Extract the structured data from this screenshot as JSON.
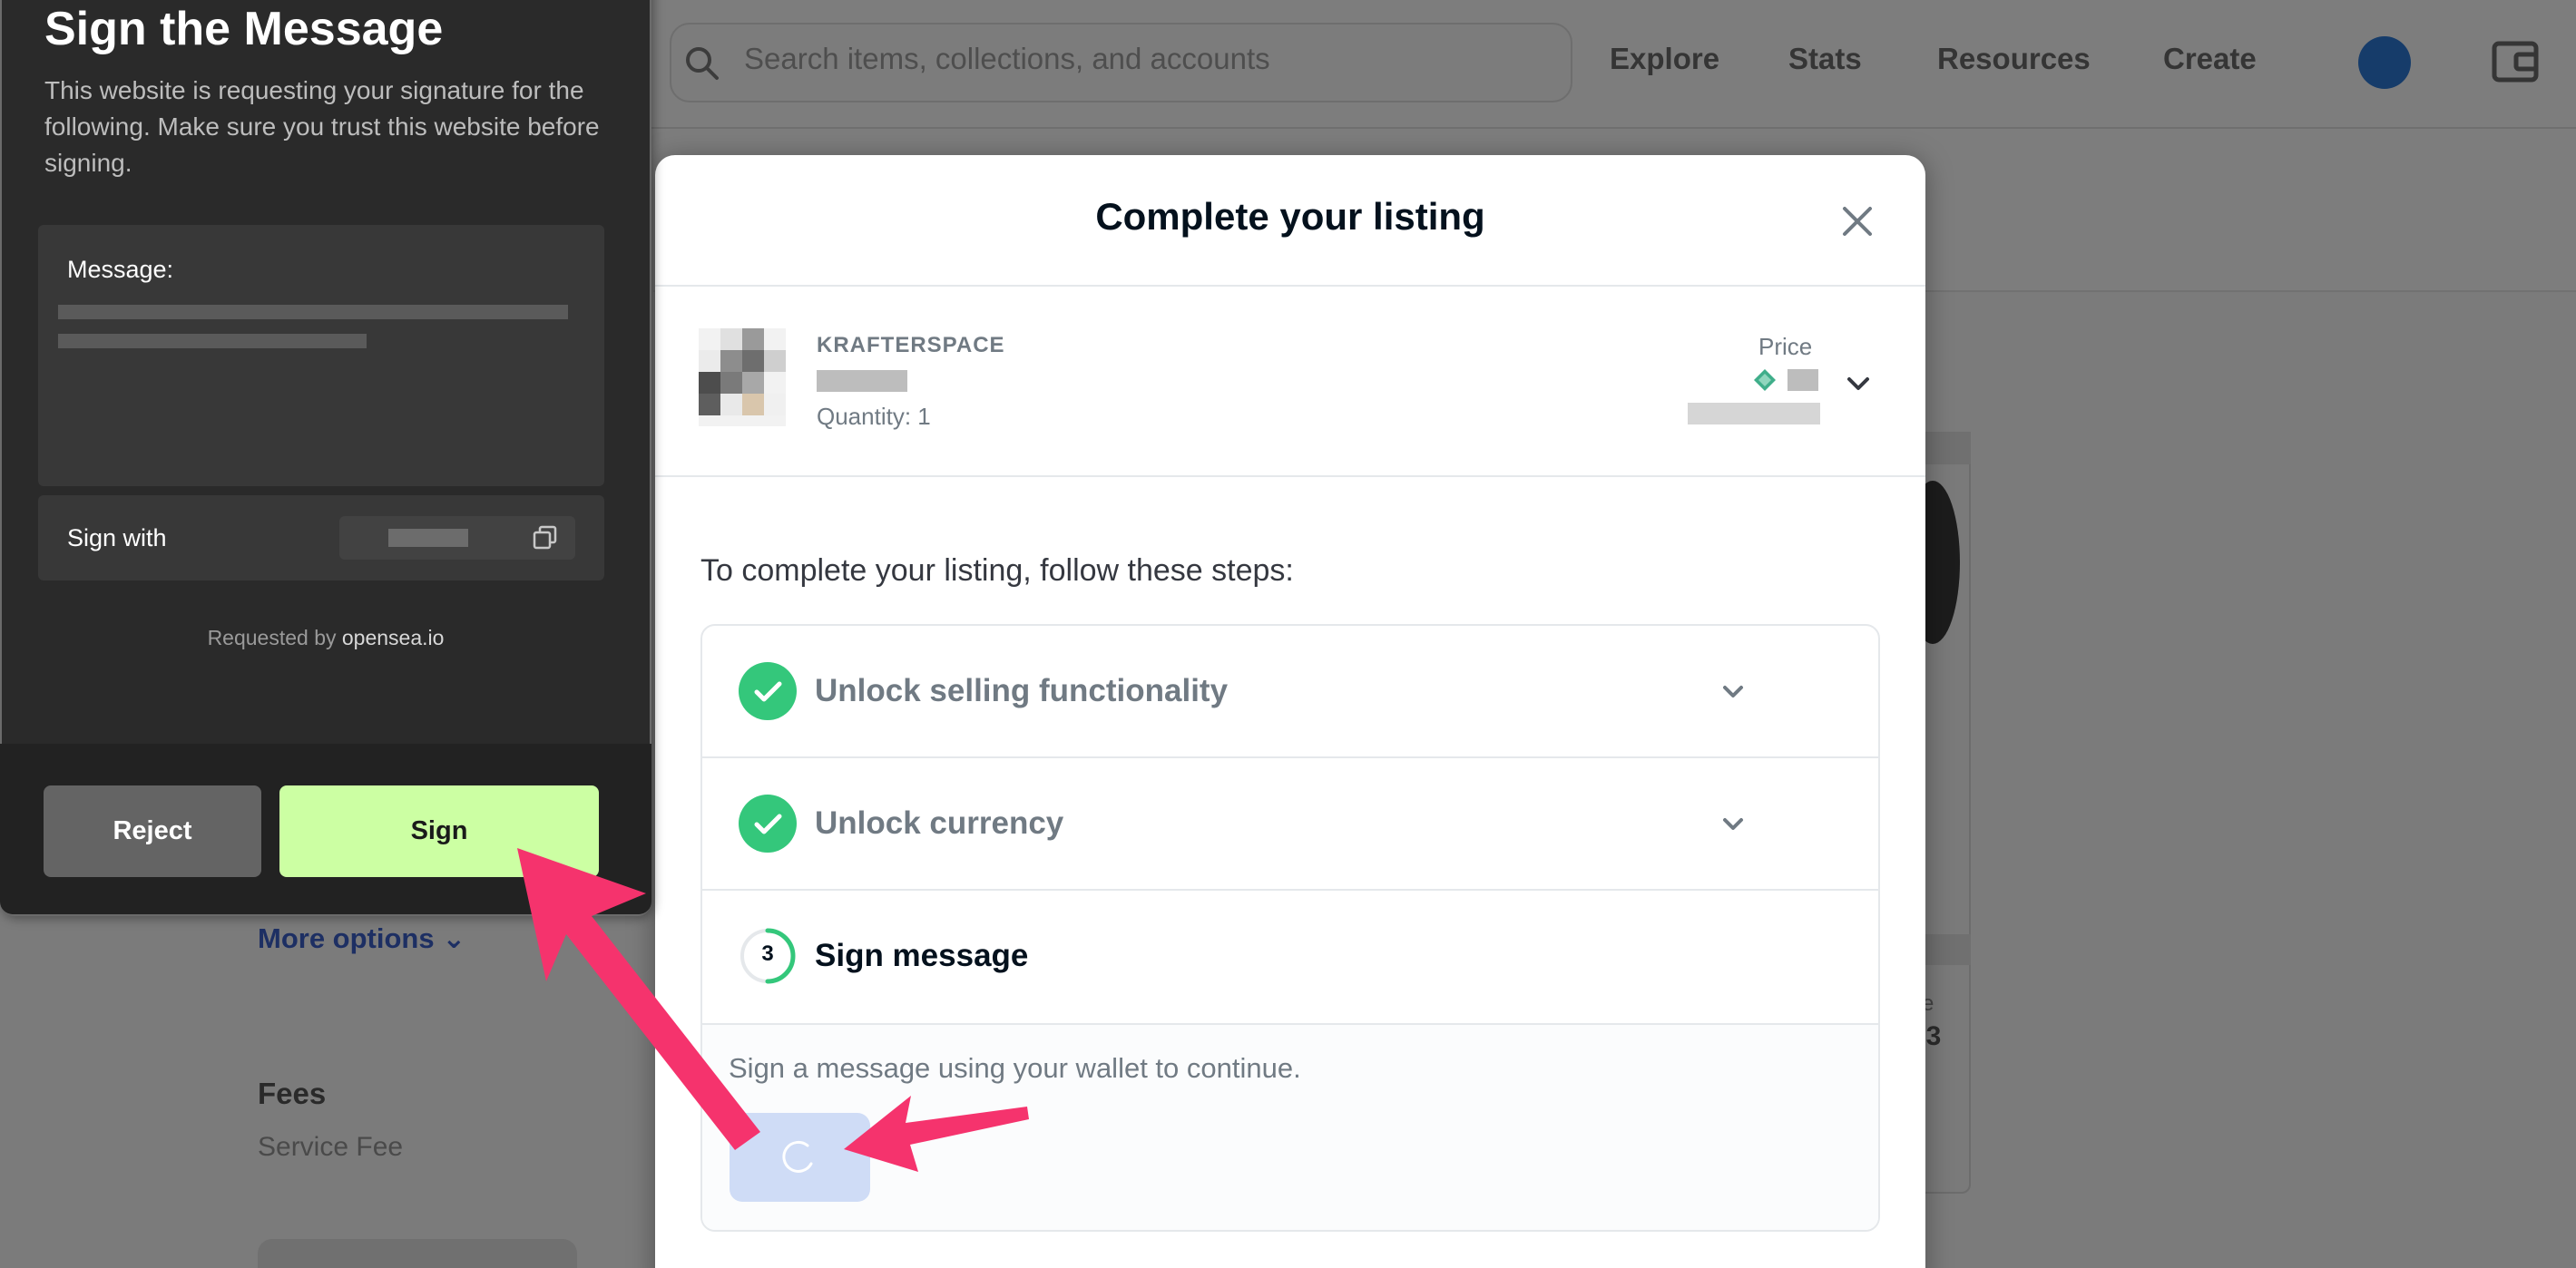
{
  "header": {
    "search_placeholder": "Search items, collections, and accounts",
    "nav": [
      "Explore",
      "Stats",
      "Resources",
      "Create"
    ]
  },
  "background_page": {
    "more_options": "More options",
    "fees_title": "Fees",
    "service_fee": "Service Fee"
  },
  "listing_modal": {
    "title": "Complete your listing",
    "collection": "KRAFTERSPACE",
    "quantity": "Quantity: 1",
    "price_label": "Price",
    "steps_intro": "To complete your listing, follow these steps:",
    "steps": [
      {
        "label": "Unlock selling functionality",
        "status": "complete"
      },
      {
        "label": "Unlock currency",
        "status": "complete"
      },
      {
        "label": "Sign message",
        "number": "3",
        "status": "in-progress"
      }
    ],
    "step_description": "Sign a message using your wallet to continue."
  },
  "wallet_popup": {
    "title": "Sign the Message",
    "description": "This website is requesting your signature for the following. Make sure you trust this website before signing.",
    "message_label": "Message:",
    "sign_with_label": "Sign with",
    "requested_by_prefix": "Requested by",
    "requested_by_site": "opensea.io",
    "reject_label": "Reject",
    "sign_label": "Sign"
  },
  "colors": {
    "check_green": "#34c77b",
    "sign_button": "#ccffa3",
    "annotation_arrow": "#f5336d",
    "loading_button": "#cfdcf6"
  },
  "icons": [
    "search-icon",
    "avatar",
    "wallet-icon",
    "close-icon",
    "chevron-down-icon",
    "check-icon",
    "copy-icon",
    "spinner-icon",
    "eth-diamond-icon"
  ]
}
